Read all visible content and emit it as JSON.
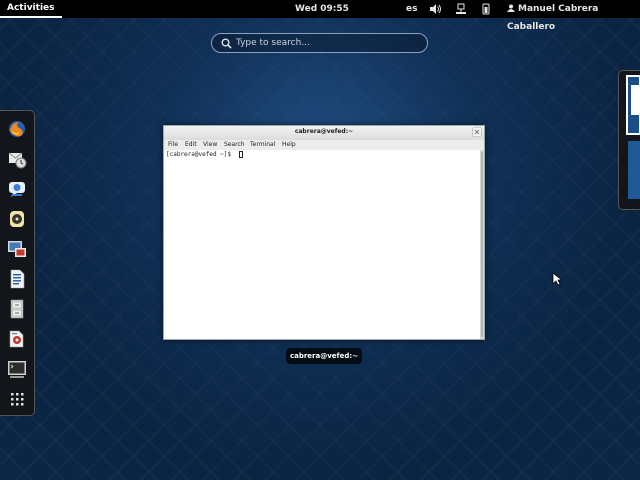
{
  "topbar": {
    "activities_label": "Activities",
    "clock": "Wed 09:55",
    "keyboard_layout": "es",
    "user_name": "Manuel Cabrera Caballero",
    "tray_icons": [
      "volume-icon",
      "network-icon",
      "power-icon"
    ]
  },
  "search": {
    "placeholder": "Type to search..."
  },
  "dash": {
    "items": [
      {
        "name": "firefox",
        "icon": "firefox-icon"
      },
      {
        "name": "evolution",
        "icon": "mail-icon"
      },
      {
        "name": "empathy",
        "icon": "chat-icon"
      },
      {
        "name": "rhythmbox",
        "icon": "music-icon"
      },
      {
        "name": "shotwell",
        "icon": "photos-icon"
      },
      {
        "name": "writer",
        "icon": "document-icon"
      },
      {
        "name": "files",
        "icon": "file-cabinet-icon"
      },
      {
        "name": "software",
        "icon": "software-icon"
      },
      {
        "name": "terminal",
        "icon": "terminal-icon"
      },
      {
        "name": "show applications",
        "icon": "grid-icon"
      }
    ]
  },
  "window": {
    "title": "cabrera@vefed:~",
    "menu": [
      "File",
      "Edit",
      "View",
      "Search",
      "Terminal",
      "Help"
    ],
    "prompt": "[cabrera@vefed ~]$ ",
    "caption": "cabrera@vefed:~"
  },
  "colors": {
    "topbar": "#000000",
    "background": "#0b2746",
    "accent": "#1a4f86"
  }
}
